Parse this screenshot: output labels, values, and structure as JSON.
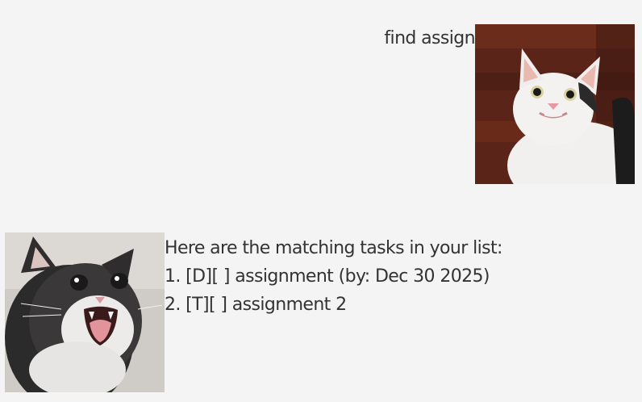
{
  "user_dialog": {
    "text": "find assign",
    "avatar_icon": "smiling-cat-avatar-icon"
  },
  "bot_dialog": {
    "lines": [
      "Here are the matching tasks in your list:",
      "1. [D][ ] assignment (by: Dec 30 2025)",
      "2. [T][ ] assignment 2"
    ],
    "avatar_icon": "crying-cat-avatar-icon"
  },
  "colors": {
    "background": "#f4f4f4",
    "text": "#333333"
  }
}
